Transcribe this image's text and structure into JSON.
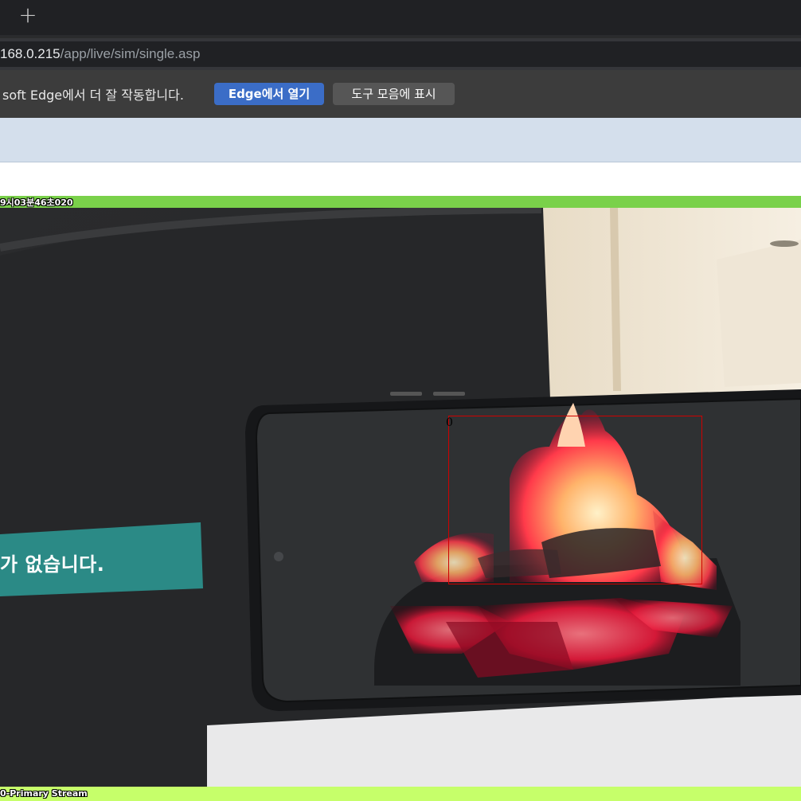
{
  "browser": {
    "new_tab_icon": "plus-icon",
    "new_tab_glyph": "+",
    "url_host": "168.0.215",
    "url_path": "/app/live/sim/single.asp",
    "infobar": {
      "message": "soft Edge에서 더 잘 작동합니다.",
      "primary_button": "Edge에서 열기",
      "secondary_button": "도구 모음에 표시"
    }
  },
  "viewer": {
    "timestamp_overlay": "9시03분46초020",
    "stream_label": "0-Primary Stream",
    "detection_label": "0",
    "screen_banner_text": "가 없습니다.",
    "colors": {
      "top_strip": "#7ad14a",
      "bottom_strip": "#c6ff6a",
      "detection_box": "#d00000"
    }
  }
}
